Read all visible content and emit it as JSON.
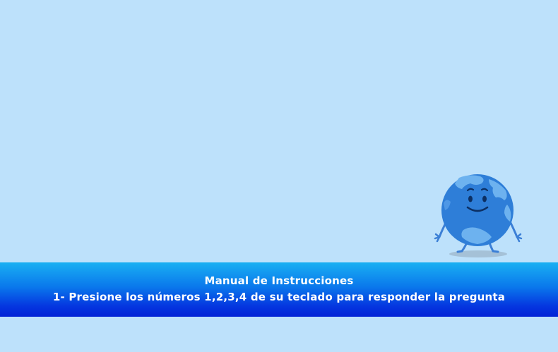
{
  "instructions": {
    "title": "Manual de Instrucciones",
    "line1": "1- Presione los números 1,2,3,4 de su teclado para responder la pregunta"
  },
  "mascot": {
    "icon": "smiling-globe-icon"
  },
  "colors": {
    "background": "#bde1fb",
    "banner_top": "#1ab0f2",
    "banner_bottom": "#0322d6",
    "globe_ocean": "#2f7fd9",
    "globe_land": "#6fb3f0"
  }
}
